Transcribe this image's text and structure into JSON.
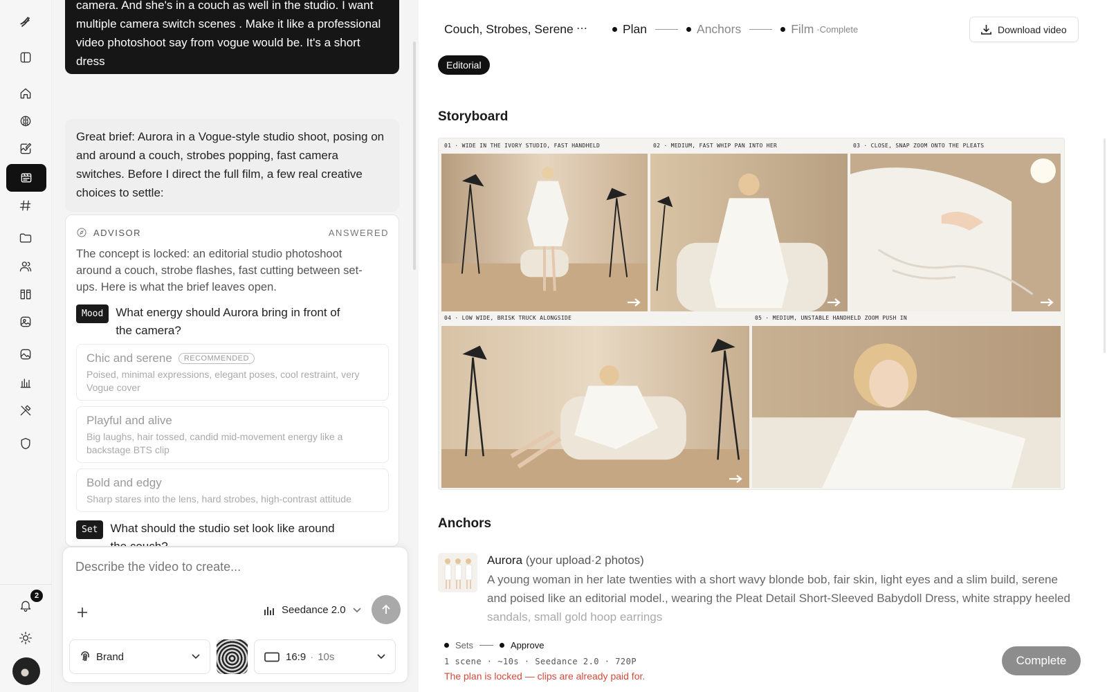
{
  "chat": {
    "user_message": "camera. And she's in a couch as well in the studio. I want multiple camera switch scenes . Make it like a professional video photoshoot say from vogue would be. It's a short dress",
    "assistant_message": "Great brief: Aurora in a Vogue-style studio shoot, posing on and around a couch, strobes popping, fast camera switches. Before I direct the full film, a few real creative choices to settle:",
    "advisor": {
      "title": "ADVISOR",
      "status": "ANSWERED",
      "description": "The concept is locked: an editorial studio photoshoot around a couch, strobe flashes, fast cutting between set-ups. Here is what the brief leaves open.",
      "questions": [
        {
          "tag": "Mood",
          "text": "What energy should Aurora bring in front of the camera?",
          "options": [
            {
              "title": "Chic and serene",
              "badge": "RECOMMENDED",
              "desc": "Poised, minimal expressions, elegant poses, cool restraint, very Vogue cover"
            },
            {
              "title": "Playful and alive",
              "badge": "",
              "desc": "Big laughs, hair tossed, candid mid-movement energy like a backstage BTS clip"
            },
            {
              "title": "Bold and edgy",
              "badge": "",
              "desc": "Sharp stares into the lens, hard strobes, high-contrast attitude"
            }
          ]
        },
        {
          "tag": "Set",
          "text": "What should the studio set look like around the couch?"
        }
      ]
    }
  },
  "composer": {
    "placeholder": "Describe the video to create...",
    "model": "Seedance 2.0",
    "brand": "Brand",
    "ratio": "16:9",
    "duration": "10s"
  },
  "rail": {
    "notification_count": "2"
  },
  "header": {
    "project_title": "Couch, Strobes, Serene",
    "more": "⋯",
    "steps": [
      {
        "label": "Plan"
      },
      {
        "label": "Anchors"
      },
      {
        "label": "Film",
        "note": "·Complete"
      }
    ],
    "download_label": "Download video"
  },
  "style_tag": "Editorial",
  "storyboard": {
    "title": "Storyboard",
    "panels": [
      {
        "caption": "01 · WIDE IN THE IVORY STUDIO, FAST HANDHELD"
      },
      {
        "caption": "02 · MEDIUM, FAST WHIP PAN INTO HER"
      },
      {
        "caption": "03 · CLOSE, SNAP ZOOM ONTO THE PLEATS"
      },
      {
        "caption": "04 · LOW WIDE, BRISK TRUCK ALONGSIDE"
      },
      {
        "caption": "05 · MEDIUM, UNSTABLE HANDHELD ZOOM PUSH IN"
      }
    ]
  },
  "anchors": {
    "title": "Anchors",
    "name": "Aurora",
    "source": "(your upload·2 photos)",
    "description": "A young woman in her late twenties with a short wavy blonde bob, fair skin, light eyes and a slim build, serene and poised like an editorial model., wearing the Pleat Detail Short-Sleeved Babydoll Dress, white strappy heeled",
    "description_faded": "sandals, small gold hoop earrings"
  },
  "footer": {
    "steps": [
      "Sets",
      "Approve"
    ],
    "meta": "1 scene · ~10s · Seedance 2.0 · 720P",
    "locked": "The plan is locked — clips are already paid for.",
    "complete_label": "Complete"
  }
}
